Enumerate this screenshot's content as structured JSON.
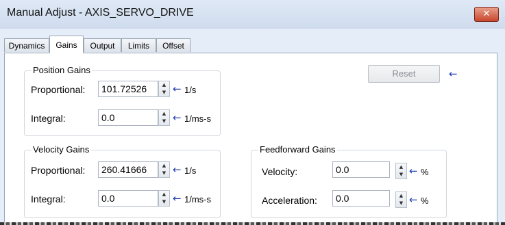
{
  "window": {
    "title": "Manual Adjust - AXIS_SERVO_DRIVE",
    "close_glyph": "✕"
  },
  "tabs": [
    {
      "label": "Dynamics",
      "active": false
    },
    {
      "label": "Gains",
      "active": true
    },
    {
      "label": "Output",
      "active": false
    },
    {
      "label": "Limits",
      "active": false
    },
    {
      "label": "Offset",
      "active": false
    }
  ],
  "reset": {
    "label": "Reset"
  },
  "position_gains": {
    "title": "Position Gains",
    "proportional": {
      "label": "Proportional:",
      "value": "101.72526",
      "unit": "1/s"
    },
    "integral": {
      "label": "Integral:",
      "value": "0.0",
      "unit": "1/ms-s"
    }
  },
  "velocity_gains": {
    "title": "Velocity Gains",
    "proportional": {
      "label": "Proportional:",
      "value": "260.41666",
      "unit": "1/s"
    },
    "integral": {
      "label": "Integral:",
      "value": "0.0",
      "unit": "1/ms-s"
    }
  },
  "feedforward_gains": {
    "title": "Feedforward Gains",
    "velocity": {
      "label": "Velocity:",
      "value": "0.0",
      "unit": "%"
    },
    "acceleration": {
      "label": "Acceleration:",
      "value": "0.0",
      "unit": "%"
    }
  },
  "icons": {
    "arrow": "←",
    "spin_up": "▲",
    "spin_down": "▼"
  },
  "colors": {
    "arrow": "#1d3fb0",
    "close_button": "#c9452c",
    "title_bar": "#dfe9f6"
  }
}
